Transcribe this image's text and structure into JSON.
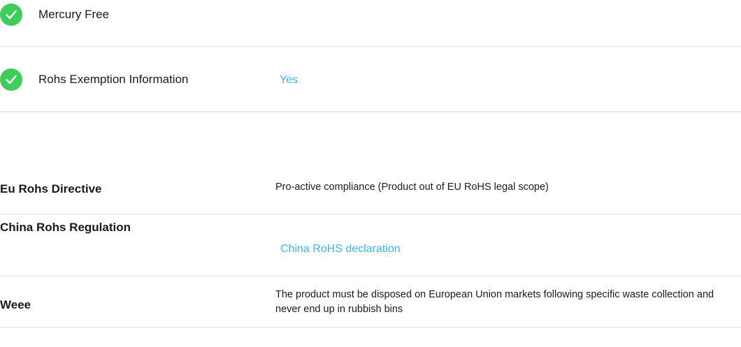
{
  "checks": [
    {
      "label": "Mercury Free",
      "value": ""
    },
    {
      "label": "Rohs Exemption Information",
      "value": "Yes"
    }
  ],
  "regulations": [
    {
      "label": "Eu Rohs Directive",
      "value": "Pro-active compliance (Product out of EU RoHS legal scope)"
    },
    {
      "label": "China Rohs Regulation",
      "link": "China RoHS declaration"
    },
    {
      "label": "Weee",
      "value": "The product must be disposed on European Union markets following specific waste collection and never end up in rubbish bins"
    }
  ],
  "colors": {
    "check_green": "#3dcd58",
    "link_blue": "#42b4e6",
    "divider": "#ececec"
  },
  "icons": {
    "check": "checkmark-circle-icon"
  }
}
